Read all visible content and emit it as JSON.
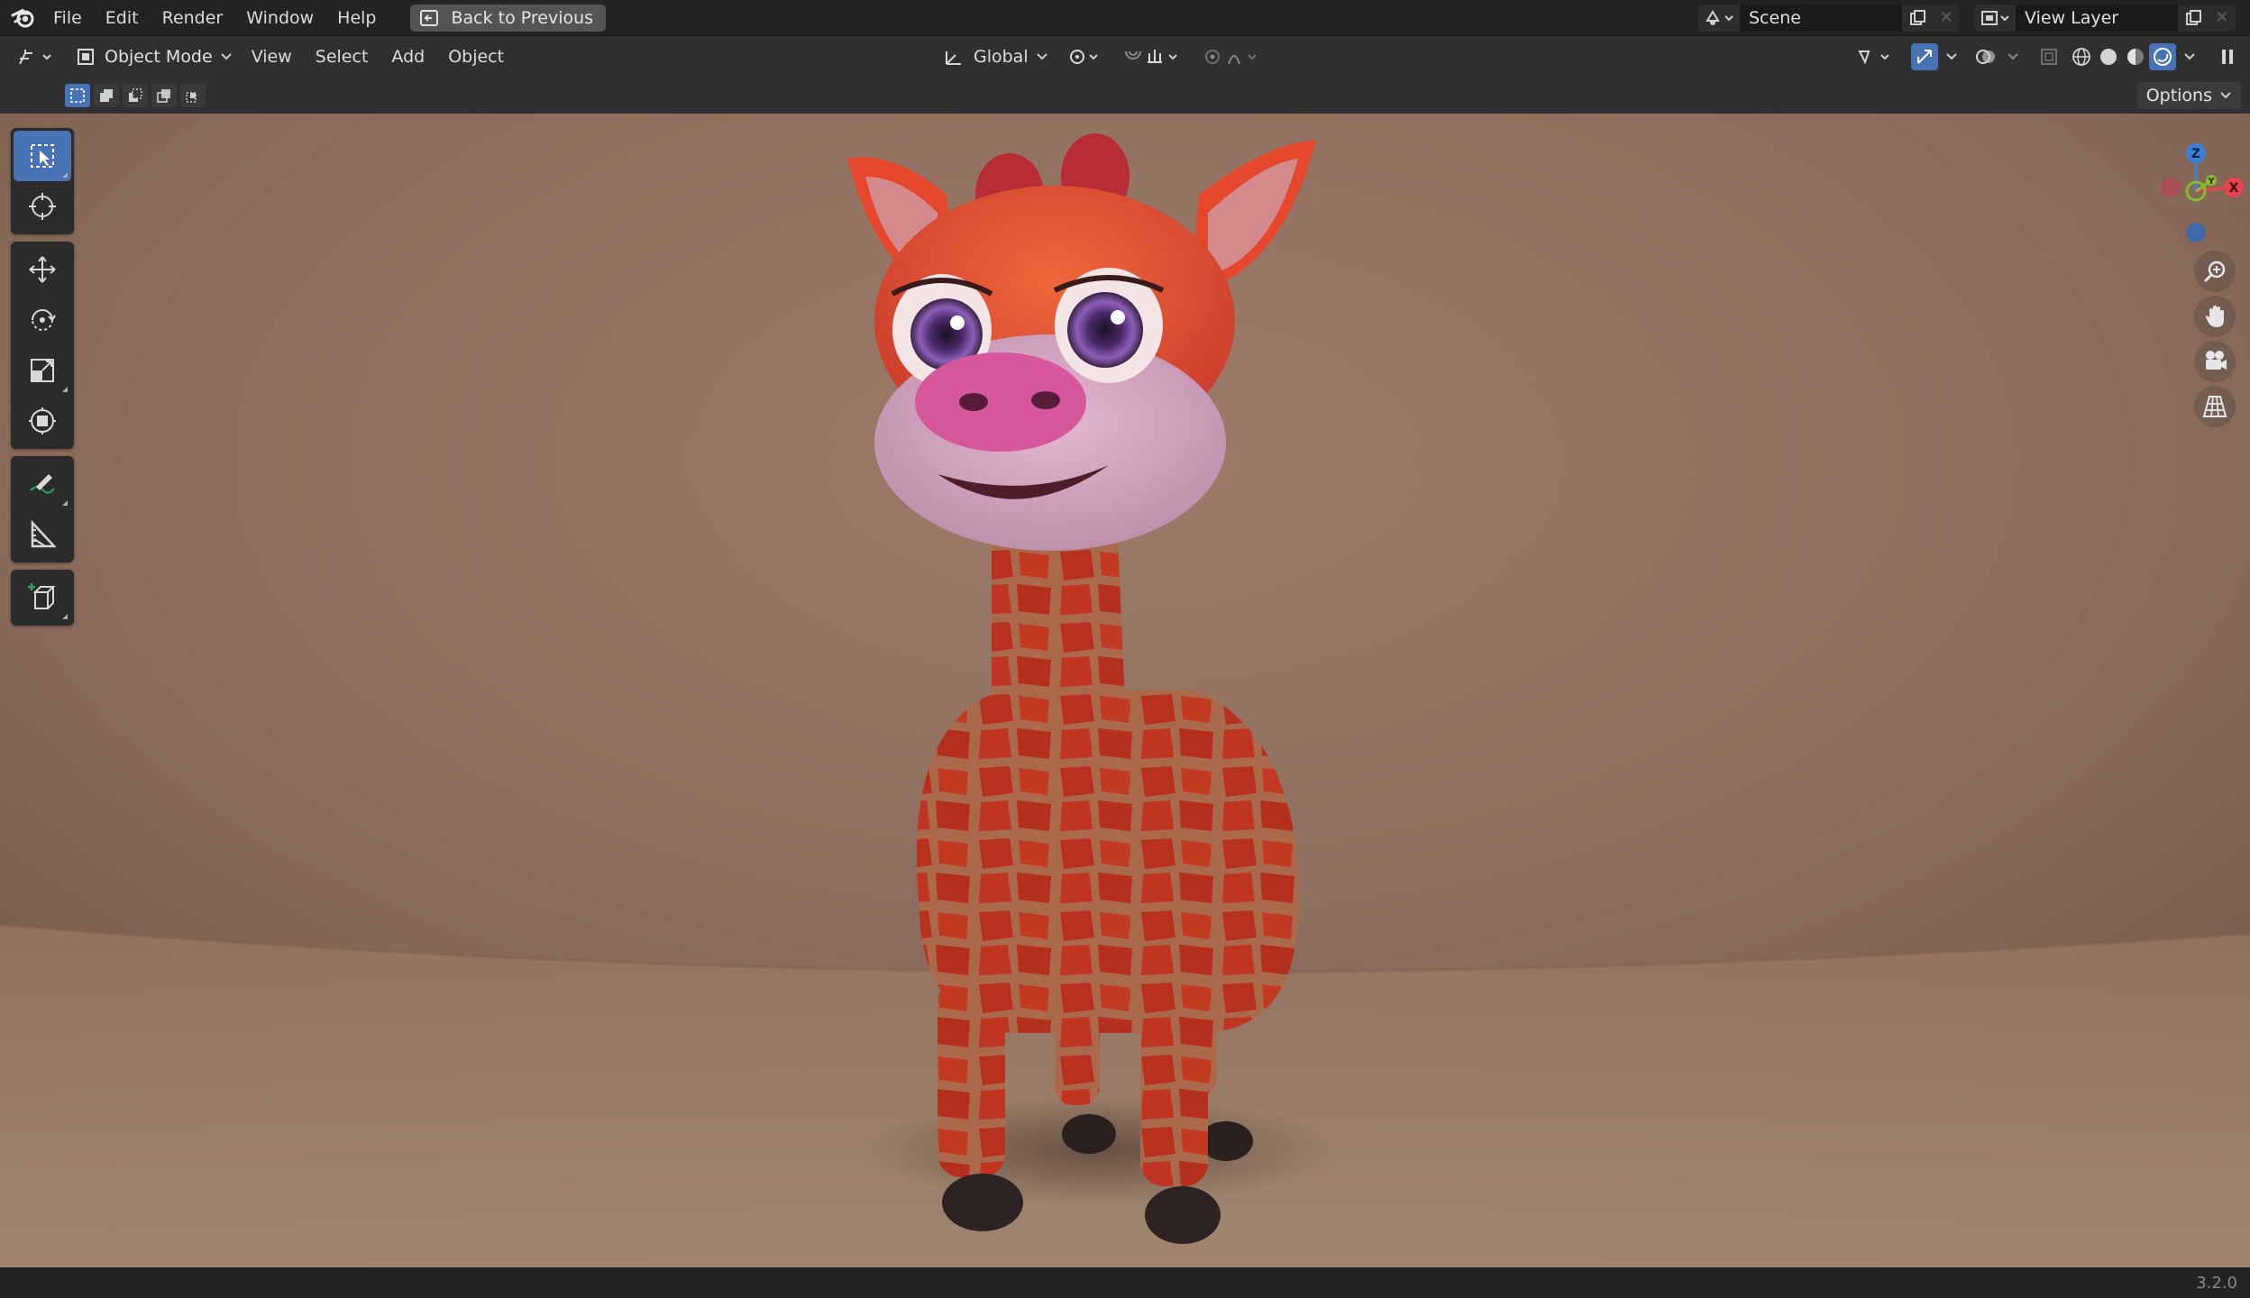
{
  "topbar": {
    "menus": [
      "File",
      "Edit",
      "Render",
      "Window",
      "Help"
    ],
    "back_button": "Back to Previous",
    "scene_label": "Scene",
    "view_layer_label": "View Layer"
  },
  "header": {
    "mode": "Object Mode",
    "menus": [
      "View",
      "Select",
      "Add",
      "Object"
    ],
    "transform_orientation": "Global",
    "options_label": "Options"
  },
  "toolbar": {
    "tools": [
      "select-box",
      "cursor",
      "move",
      "rotate",
      "scale",
      "transform",
      "annotate",
      "measure",
      "add-cube"
    ],
    "active_tool": "select-box"
  },
  "gizmo": {
    "axes": [
      "X",
      "Y",
      "Z"
    ],
    "x_color": "#e8434f",
    "y_color": "#8bbb2c",
    "z_color": "#3a82d8"
  },
  "nav": {
    "buttons": [
      "zoom-icon",
      "hand-icon",
      "camera-icon",
      "grid-icon"
    ]
  },
  "colors": {
    "accent": "#4772b3",
    "background": "#1d1d1d"
  },
  "status": {
    "version": "3.2.0"
  }
}
